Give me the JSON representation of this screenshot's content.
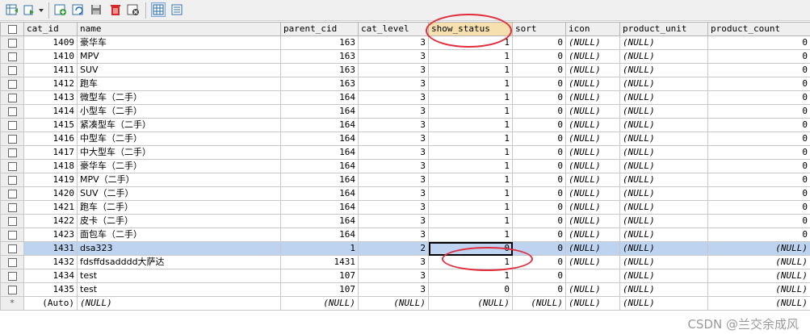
{
  "grid": {
    "columns": [
      "cat_id",
      "name",
      "parent_cid",
      "cat_level",
      "show_status",
      "sort",
      "icon",
      "product_unit",
      "product_count"
    ],
    "rows": [
      [
        "1409",
        "豪华车",
        "163",
        "3",
        "1",
        "0",
        "(NULL)",
        "(NULL)",
        "0"
      ],
      [
        "1410",
        "MPV",
        "163",
        "3",
        "1",
        "0",
        "(NULL)",
        "(NULL)",
        "0"
      ],
      [
        "1411",
        "SUV",
        "163",
        "3",
        "1",
        "0",
        "(NULL)",
        "(NULL)",
        "0"
      ],
      [
        "1412",
        "跑车",
        "163",
        "3",
        "1",
        "0",
        "(NULL)",
        "(NULL)",
        "0"
      ],
      [
        "1413",
        "微型车（二手）",
        "164",
        "3",
        "1",
        "0",
        "(NULL)",
        "(NULL)",
        "0"
      ],
      [
        "1414",
        "小型车（二手）",
        "164",
        "3",
        "1",
        "0",
        "(NULL)",
        "(NULL)",
        "0"
      ],
      [
        "1415",
        "紧凑型车（二手）",
        "164",
        "3",
        "1",
        "0",
        "(NULL)",
        "(NULL)",
        "0"
      ],
      [
        "1416",
        "中型车（二手）",
        "164",
        "3",
        "1",
        "0",
        "(NULL)",
        "(NULL)",
        "0"
      ],
      [
        "1417",
        "中大型车（二手）",
        "164",
        "3",
        "1",
        "0",
        "(NULL)",
        "(NULL)",
        "0"
      ],
      [
        "1418",
        "豪华车（二手）",
        "164",
        "3",
        "1",
        "0",
        "(NULL)",
        "(NULL)",
        "0"
      ],
      [
        "1419",
        "MPV（二手）",
        "164",
        "3",
        "1",
        "0",
        "(NULL)",
        "(NULL)",
        "0"
      ],
      [
        "1420",
        "SUV（二手）",
        "164",
        "3",
        "1",
        "0",
        "(NULL)",
        "(NULL)",
        "0"
      ],
      [
        "1421",
        "跑车（二手）",
        "164",
        "3",
        "1",
        "0",
        "(NULL)",
        "(NULL)",
        "0"
      ],
      [
        "1422",
        "皮卡（二手）",
        "164",
        "3",
        "1",
        "0",
        "(NULL)",
        "(NULL)",
        "0"
      ],
      [
        "1423",
        "面包车（二手）",
        "164",
        "3",
        "1",
        "0",
        "(NULL)",
        "(NULL)",
        "0"
      ],
      [
        "1431",
        "dsa323",
        "1",
        "2",
        "0",
        "0",
        "(NULL)",
        "(NULL)",
        "(NULL)"
      ],
      [
        "1432",
        "fdsffdsadddd大萨达",
        "1431",
        "3",
        "1",
        "0",
        "(NULL)",
        "(NULL)",
        "(NULL)"
      ],
      [
        "1434",
        "test",
        "107",
        "3",
        "1",
        "0",
        "",
        "(NULL)",
        "(NULL)"
      ],
      [
        "1435",
        "test",
        "107",
        "3",
        "0",
        "0",
        "(NULL)",
        "(NULL)",
        "(NULL)"
      ]
    ],
    "new_row": [
      "(Auto)",
      "(NULL)",
      "(NULL)",
      "(NULL)",
      "(NULL)",
      "(NULL)",
      "(NULL)",
      "(NULL)",
      "(NULL)"
    ],
    "new_row_marker": "*",
    "selected_row_index": 15
  },
  "toolbar": {
    "icons": [
      "insert-row-icon",
      "save-dropdown-icon",
      "add-row-icon",
      "refresh-icon",
      "save-icon",
      "delete-icon",
      "cancel-icon",
      "grid-view-icon",
      "form-view-icon"
    ]
  },
  "watermark": "CSDN @兰交余成风",
  "colors": {
    "selected_row": "#bdd3f0",
    "highlight_header": "#f6e0b0",
    "annotation": "#e12d3c"
  }
}
